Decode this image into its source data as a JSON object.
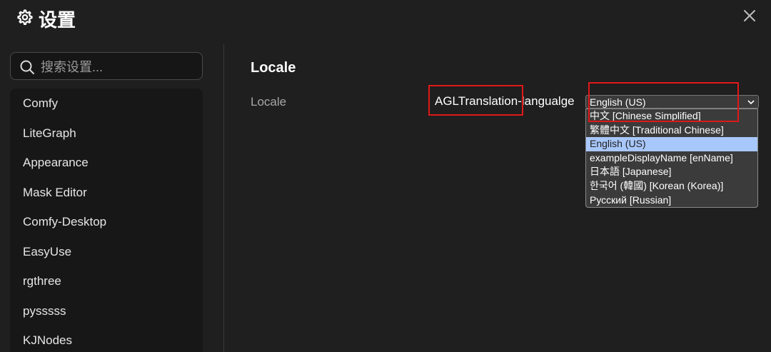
{
  "dialog": {
    "title": "设置",
    "title_icon": "gear-icon",
    "close_icon": "close-icon"
  },
  "search": {
    "placeholder": "搜索设置...",
    "value": "",
    "icon": "search-icon"
  },
  "sidebar": {
    "items": [
      {
        "label": "Comfy"
      },
      {
        "label": "LiteGraph"
      },
      {
        "label": "Appearance"
      },
      {
        "label": "Mask Editor"
      },
      {
        "label": "Comfy-Desktop"
      },
      {
        "label": "EasyUse"
      },
      {
        "label": "rgthree"
      },
      {
        "label": "pysssss"
      },
      {
        "label": "KJNodes"
      }
    ]
  },
  "main": {
    "section_title": "Locale",
    "row_label": "Locale",
    "setting_id": "AGLTranslation-langualge",
    "select": {
      "value": "English (US)",
      "chevron_icon": "chevron-down-icon",
      "options": [
        {
          "label": "中文 [Chinese Simplified]",
          "selected": false
        },
        {
          "label": "繁體中文 [Traditional Chinese]",
          "selected": false
        },
        {
          "label": "English (US)",
          "selected": true
        },
        {
          "label": "exampleDisplayName [enName]",
          "selected": false
        },
        {
          "label": "日本語 [Japanese]",
          "selected": false
        },
        {
          "label": "한국어 (韓國) [Korean (Korea)]",
          "selected": false
        },
        {
          "label": "Русский [Russian]",
          "selected": false
        }
      ]
    }
  },
  "colors": {
    "background": "#1f1f1f",
    "highlight_box": "#e01818",
    "selected_option": "#a8c7fa"
  }
}
